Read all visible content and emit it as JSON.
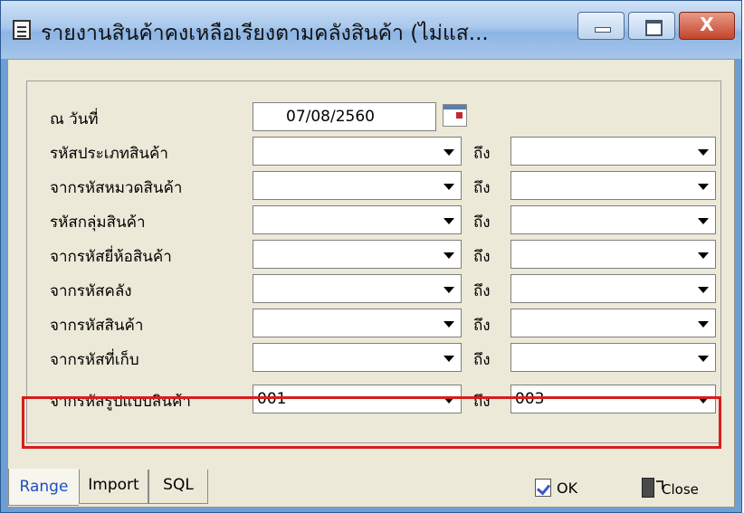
{
  "window": {
    "title": "รายงานสินค้าคงเหลือเรียงตามคลังสินค้า (ไม่แส...",
    "close_glyph": "X"
  },
  "form": {
    "date_label": "ณ วันที่",
    "date_value": "07/08/2560",
    "to_label": "ถึง",
    "rows": [
      {
        "label": "รหัสประเภทสินค้า",
        "from": "",
        "to": ""
      },
      {
        "label": "จากรหัสหมวดสินค้า",
        "from": "",
        "to": ""
      },
      {
        "label": "รหัสกลุ่มสินค้า",
        "from": "",
        "to": ""
      },
      {
        "label": "จากรหัสยี่ห้อสินค้า",
        "from": "",
        "to": ""
      },
      {
        "label": "จากรหัสคลัง",
        "from": "",
        "to": ""
      },
      {
        "label": "จากรหัสสินค้า",
        "from": "",
        "to": ""
      },
      {
        "label": "จากรหัสที่เก็บ",
        "from": "",
        "to": ""
      },
      {
        "label": "จากรหัสรูปแบบสินค้า",
        "from": "001",
        "to": "003"
      }
    ]
  },
  "tabs": [
    "Range",
    "Import",
    "SQL"
  ],
  "buttons": {
    "ok": "OK",
    "close": "Close"
  },
  "colors": {
    "highlight": "#d71d1d",
    "active_tab_text": "#1f4fc2"
  },
  "icons": [
    "calendar-icon",
    "ok-icon",
    "exit-icon",
    "window-icon"
  ]
}
